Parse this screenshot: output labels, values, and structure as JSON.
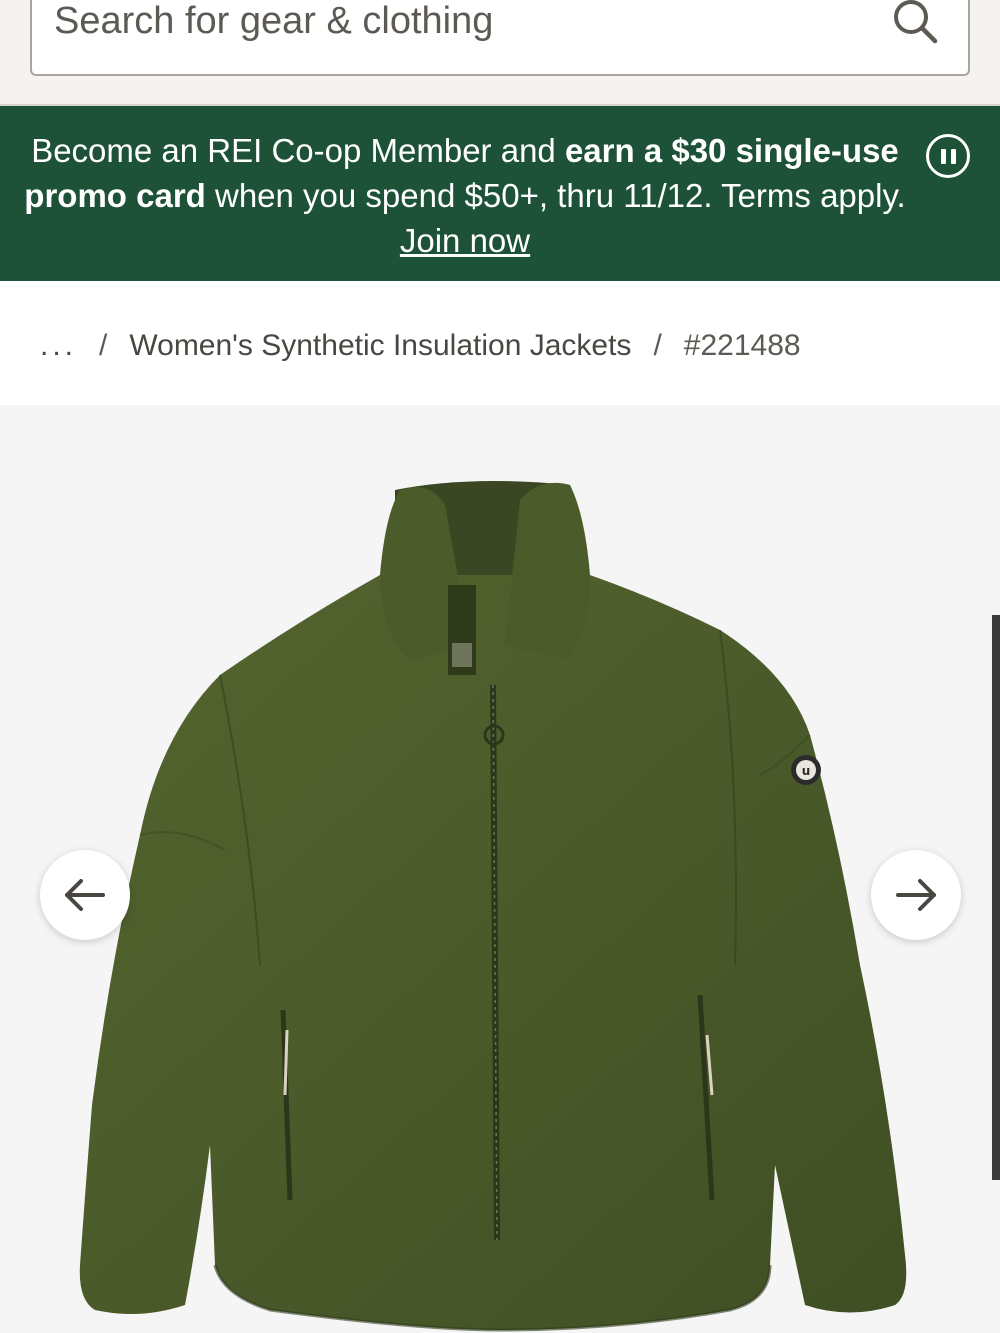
{
  "search": {
    "placeholder": "Search for gear & clothing",
    "icon": "search-icon"
  },
  "promo": {
    "text_1": "Become an REI Co-op Member and ",
    "bold_1": "earn a $30 single-use promo card",
    "text_2": " when you spend $50+, thru 11/12. Terms apply. ",
    "link": "Join now",
    "pause_icon": "pause-icon",
    "background_color": "#1d5238"
  },
  "breadcrumb": {
    "ellipsis": "...",
    "separator": "/",
    "category": "Women's Synthetic Insulation Jackets",
    "product_id": "#221488"
  },
  "gallery": {
    "prev_icon": "arrow-left-icon",
    "next_icon": "arrow-right-icon",
    "product_color": "#4a5a2d"
  }
}
